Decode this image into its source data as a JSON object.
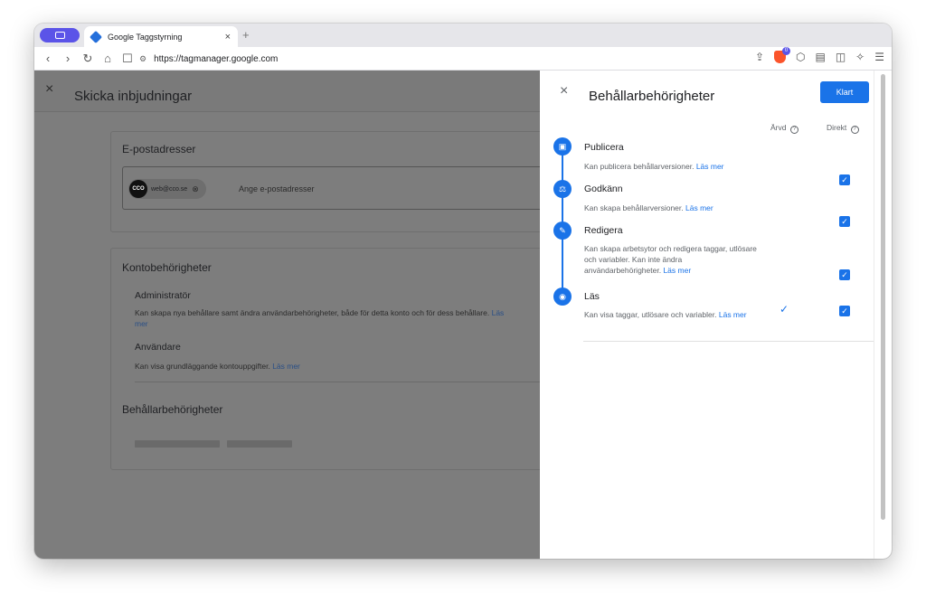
{
  "browser": {
    "tab_title": "Google Taggstyrning",
    "tab_close": "×",
    "new_tab": "+",
    "url": "https://tagmanager.google.com",
    "nav": {
      "back": "‹",
      "forward": "›",
      "reload": "↻",
      "home": "⌂",
      "bookmark": "☐"
    },
    "extension_badge": "0",
    "icons": [
      "share-icon",
      "brave-shield-icon",
      "extensions-icon",
      "reader-icon",
      "sidebar-icon",
      "leo-icon",
      "menu-icon"
    ]
  },
  "main": {
    "close": "×",
    "title": "Skicka inbjudningar",
    "email_card": {
      "heading": "E-postadresser",
      "chip_avatar": "CCO",
      "chip_email": "web@cco.se",
      "chip_remove": "⊗",
      "input_placeholder": "Ange e-postadresser"
    },
    "account_card": {
      "heading": "Kontobehörigheter",
      "roles": [
        {
          "title": "Administratör",
          "desc": "Kan skapa nya behållare samt ändra användarbehörigheter, både för detta konto och för dess behållare.",
          "link": "Läs mer"
        },
        {
          "title": "Användare",
          "desc": "Kan visa grundläggande kontouppgifter.",
          "link": "Läs mer"
        }
      ],
      "container_heading": "Behållarbehörigheter"
    }
  },
  "panel": {
    "close": "×",
    "title": "Behållarbehörigheter",
    "done_label": "Klart",
    "col_inherited": "Ärvd",
    "col_direct": "Direkt",
    "help_glyph": "?",
    "permissions": [
      {
        "name": "Publicera",
        "desc": "Kan publicera behållarversioner.",
        "link": "Läs mer",
        "direct": true,
        "inherited": false,
        "icon": "publish-icon",
        "glyph": "▣"
      },
      {
        "name": "Godkänn",
        "desc": "Kan skapa behållarversioner.",
        "link": "Läs mer",
        "direct": true,
        "inherited": false,
        "icon": "approve-gavel-icon",
        "glyph": "⚖"
      },
      {
        "name": "Redigera",
        "desc": "Kan skapa arbetsytor och redigera taggar, utlösare och variabler. Kan inte ändra användarbehörigheter.",
        "link": "Läs mer",
        "direct": true,
        "inherited": false,
        "icon": "edit-pencil-icon",
        "glyph": "✎"
      },
      {
        "name": "Läs",
        "desc": "Kan visa taggar, utlösare och variabler.",
        "link": "Läs mer",
        "direct": true,
        "inherited": true,
        "icon": "read-eye-icon",
        "glyph": "◉"
      }
    ],
    "check_glyph": "✓"
  },
  "colors": {
    "accent": "#1a73e8",
    "scrim": "#7d7d7d",
    "brave": "#fb542b",
    "sidebar_pill": "#5b54e8"
  }
}
